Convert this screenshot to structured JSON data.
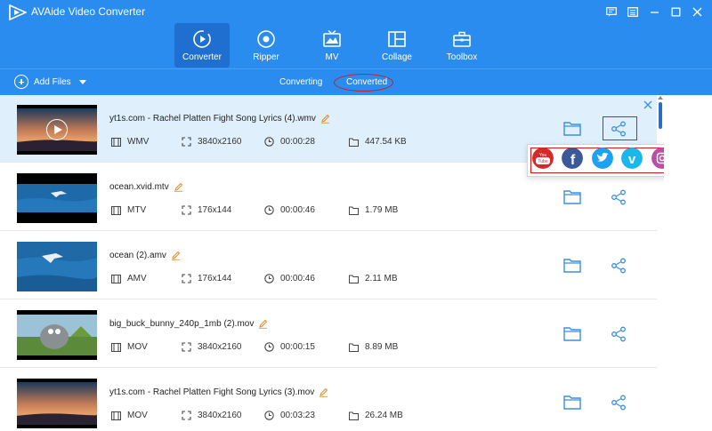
{
  "app": {
    "title": "AVAide Video Converter"
  },
  "window_controls": [
    "feedback-icon",
    "menu-icon",
    "minimize-icon",
    "maximize-icon",
    "close-icon"
  ],
  "nav": {
    "items": [
      {
        "label": "Converter",
        "icon": "converter-icon",
        "active": true
      },
      {
        "label": "Ripper",
        "icon": "ripper-icon",
        "active": false
      },
      {
        "label": "MV",
        "icon": "mv-icon",
        "active": false
      },
      {
        "label": "Collage",
        "icon": "collage-icon",
        "active": false
      },
      {
        "label": "Toolbox",
        "icon": "toolbox-icon",
        "active": false
      }
    ]
  },
  "toolbar": {
    "add_files_label": "Add Files",
    "tabs": {
      "converting": "Converting",
      "converted": "Converted"
    },
    "active_tab": "Converted"
  },
  "files": [
    {
      "name": "yt1s.com - Rachel Platten  Fight Song Lyrics (4).wmv",
      "format": "WMV",
      "resolution": "3840x2160",
      "duration": "00:00:28",
      "size": "447.54 KB",
      "thumbnail": "sunset",
      "selected": true
    },
    {
      "name": "ocean.xvid.mtv",
      "format": "MTV",
      "resolution": "176x144",
      "duration": "00:00:46",
      "size": "1.79 MB",
      "thumbnail": "ocean-letterbox",
      "selected": false
    },
    {
      "name": "ocean (2).amv",
      "format": "AMV",
      "resolution": "176x144",
      "duration": "00:00:46",
      "size": "2.11 MB",
      "thumbnail": "ocean",
      "selected": false
    },
    {
      "name": "big_buck_bunny_240p_1mb (2).mov",
      "format": "MOV",
      "resolution": "3840x2160",
      "duration": "00:00:15",
      "size": "8.89 MB",
      "thumbnail": "bunny",
      "selected": false
    },
    {
      "name": "yt1s.com - Rachel Platten  Fight Song Lyrics (3).mov",
      "format": "MOV",
      "resolution": "3840x2160",
      "duration": "00:03:23",
      "size": "26.24 MB",
      "thumbnail": "sunset",
      "selected": false
    }
  ],
  "share_popup": {
    "platforms": [
      {
        "name": "youtube-icon",
        "label": "You Tube",
        "color": "#d32a2a"
      },
      {
        "name": "facebook-icon",
        "label": "f",
        "color": "#3b5998"
      },
      {
        "name": "twitter-icon",
        "label": "",
        "color": "#1da1f2"
      },
      {
        "name": "vimeo-icon",
        "label": "v",
        "color": "#1ab7ea"
      },
      {
        "name": "instagram-icon",
        "label": "",
        "color": "#b94fa6"
      },
      {
        "name": "flickr-icon",
        "label": "",
        "color": "#ff0084"
      }
    ]
  },
  "colors": {
    "accent": "#2b8cf0",
    "nav_active": "#1f6fd0",
    "selected_row": "#dff0fc",
    "highlight_red": "#d21b1b",
    "icon_blue": "#3a8fe0"
  }
}
